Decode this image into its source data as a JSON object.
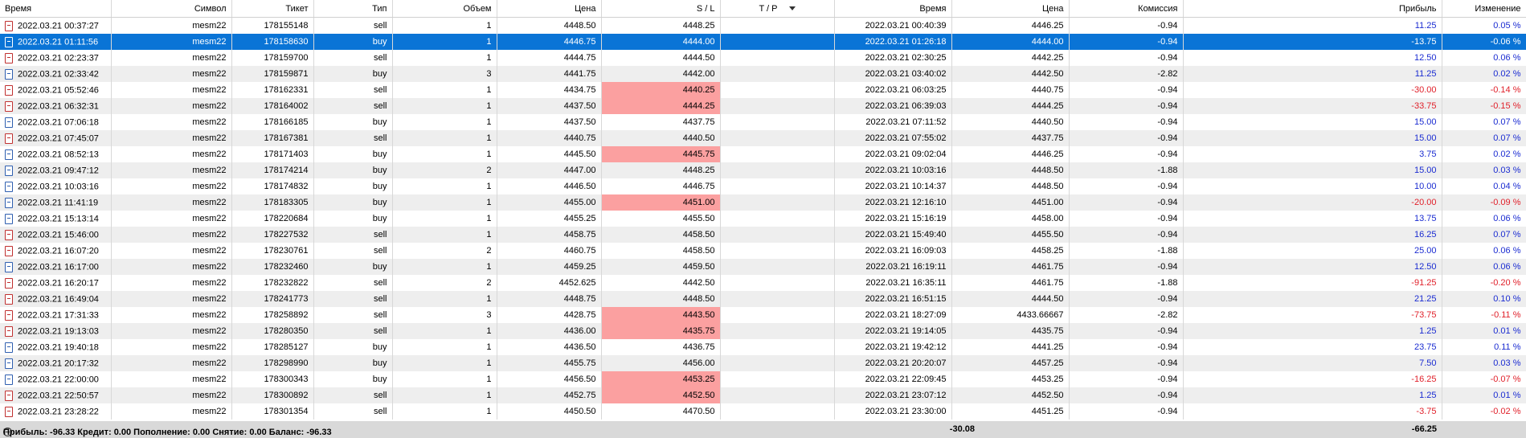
{
  "columns": {
    "time_open": "Время",
    "symbol": "Символ",
    "ticket": "Тикет",
    "type": "Тип",
    "volume": "Объем",
    "price_open": "Цена",
    "sl": "S / L",
    "tp": "T / P",
    "time_close": "Время",
    "price_close": "Цена",
    "commission": "Комиссия",
    "profit": "Прибыль",
    "change": "Изменение"
  },
  "rows": [
    {
      "t1": "2022.03.21 00:37:27",
      "sym": "mesm22",
      "ticket": "178155148",
      "type": "sell",
      "vol": "1",
      "p1": "4448.50",
      "sl": "4448.25",
      "tp": "",
      "t2": "2022.03.21 00:40:39",
      "p2": "4446.25",
      "comm": "-0.94",
      "profit": "11.25",
      "chg": "0.05 %",
      "sel": false,
      "slhit": false
    },
    {
      "t1": "2022.03.21 01:11:56",
      "sym": "mesm22",
      "ticket": "178158630",
      "type": "buy",
      "vol": "1",
      "p1": "4446.75",
      "sl": "4444.00",
      "tp": "",
      "t2": "2022.03.21 01:26:18",
      "p2": "4444.00",
      "comm": "-0.94",
      "profit": "-13.75",
      "chg": "-0.06 %",
      "sel": true,
      "slhit": false
    },
    {
      "t1": "2022.03.21 02:23:37",
      "sym": "mesm22",
      "ticket": "178159700",
      "type": "sell",
      "vol": "1",
      "p1": "4444.75",
      "sl": "4444.50",
      "tp": "",
      "t2": "2022.03.21 02:30:25",
      "p2": "4442.25",
      "comm": "-0.94",
      "profit": "12.50",
      "chg": "0.06 %",
      "sel": false,
      "slhit": false
    },
    {
      "t1": "2022.03.21 02:33:42",
      "sym": "mesm22",
      "ticket": "178159871",
      "type": "buy",
      "vol": "3",
      "p1": "4441.75",
      "sl": "4442.00",
      "tp": "",
      "t2": "2022.03.21 03:40:02",
      "p2": "4442.50",
      "comm": "-2.82",
      "profit": "11.25",
      "chg": "0.02 %",
      "sel": false,
      "slhit": false
    },
    {
      "t1": "2022.03.21 05:52:46",
      "sym": "mesm22",
      "ticket": "178162331",
      "type": "sell",
      "vol": "1",
      "p1": "4434.75",
      "sl": "4440.25",
      "tp": "",
      "t2": "2022.03.21 06:03:25",
      "p2": "4440.75",
      "comm": "-0.94",
      "profit": "-30.00",
      "chg": "-0.14 %",
      "sel": false,
      "slhit": true
    },
    {
      "t1": "2022.03.21 06:32:31",
      "sym": "mesm22",
      "ticket": "178164002",
      "type": "sell",
      "vol": "1",
      "p1": "4437.50",
      "sl": "4444.25",
      "tp": "",
      "t2": "2022.03.21 06:39:03",
      "p2": "4444.25",
      "comm": "-0.94",
      "profit": "-33.75",
      "chg": "-0.15 %",
      "sel": false,
      "slhit": true
    },
    {
      "t1": "2022.03.21 07:06:18",
      "sym": "mesm22",
      "ticket": "178166185",
      "type": "buy",
      "vol": "1",
      "p1": "4437.50",
      "sl": "4437.75",
      "tp": "",
      "t2": "2022.03.21 07:11:52",
      "p2": "4440.50",
      "comm": "-0.94",
      "profit": "15.00",
      "chg": "0.07 %",
      "sel": false,
      "slhit": false
    },
    {
      "t1": "2022.03.21 07:45:07",
      "sym": "mesm22",
      "ticket": "178167381",
      "type": "sell",
      "vol": "1",
      "p1": "4440.75",
      "sl": "4440.50",
      "tp": "",
      "t2": "2022.03.21 07:55:02",
      "p2": "4437.75",
      "comm": "-0.94",
      "profit": "15.00",
      "chg": "0.07 %",
      "sel": false,
      "slhit": false
    },
    {
      "t1": "2022.03.21 08:52:13",
      "sym": "mesm22",
      "ticket": "178171403",
      "type": "buy",
      "vol": "1",
      "p1": "4445.50",
      "sl": "4445.75",
      "tp": "",
      "t2": "2022.03.21 09:02:04",
      "p2": "4446.25",
      "comm": "-0.94",
      "profit": "3.75",
      "chg": "0.02 %",
      "sel": false,
      "slhit": true
    },
    {
      "t1": "2022.03.21 09:47:12",
      "sym": "mesm22",
      "ticket": "178174214",
      "type": "buy",
      "vol": "2",
      "p1": "4447.00",
      "sl": "4448.25",
      "tp": "",
      "t2": "2022.03.21 10:03:16",
      "p2": "4448.50",
      "comm": "-1.88",
      "profit": "15.00",
      "chg": "0.03 %",
      "sel": false,
      "slhit": false
    },
    {
      "t1": "2022.03.21 10:03:16",
      "sym": "mesm22",
      "ticket": "178174832",
      "type": "buy",
      "vol": "1",
      "p1": "4446.50",
      "sl": "4446.75",
      "tp": "",
      "t2": "2022.03.21 10:14:37",
      "p2": "4448.50",
      "comm": "-0.94",
      "profit": "10.00",
      "chg": "0.04 %",
      "sel": false,
      "slhit": false
    },
    {
      "t1": "2022.03.21 11:41:19",
      "sym": "mesm22",
      "ticket": "178183305",
      "type": "buy",
      "vol": "1",
      "p1": "4455.00",
      "sl": "4451.00",
      "tp": "",
      "t2": "2022.03.21 12:16:10",
      "p2": "4451.00",
      "comm": "-0.94",
      "profit": "-20.00",
      "chg": "-0.09 %",
      "sel": false,
      "slhit": true
    },
    {
      "t1": "2022.03.21 15:13:14",
      "sym": "mesm22",
      "ticket": "178220684",
      "type": "buy",
      "vol": "1",
      "p1": "4455.25",
      "sl": "4455.50",
      "tp": "",
      "t2": "2022.03.21 15:16:19",
      "p2": "4458.00",
      "comm": "-0.94",
      "profit": "13.75",
      "chg": "0.06 %",
      "sel": false,
      "slhit": false
    },
    {
      "t1": "2022.03.21 15:46:00",
      "sym": "mesm22",
      "ticket": "178227532",
      "type": "sell",
      "vol": "1",
      "p1": "4458.75",
      "sl": "4458.50",
      "tp": "",
      "t2": "2022.03.21 15:49:40",
      "p2": "4455.50",
      "comm": "-0.94",
      "profit": "16.25",
      "chg": "0.07 %",
      "sel": false,
      "slhit": false
    },
    {
      "t1": "2022.03.21 16:07:20",
      "sym": "mesm22",
      "ticket": "178230761",
      "type": "sell",
      "vol": "2",
      "p1": "4460.75",
      "sl": "4458.50",
      "tp": "",
      "t2": "2022.03.21 16:09:03",
      "p2": "4458.25",
      "comm": "-1.88",
      "profit": "25.00",
      "chg": "0.06 %",
      "sel": false,
      "slhit": false
    },
    {
      "t1": "2022.03.21 16:17:00",
      "sym": "mesm22",
      "ticket": "178232460",
      "type": "buy",
      "vol": "1",
      "p1": "4459.25",
      "sl": "4459.50",
      "tp": "",
      "t2": "2022.03.21 16:19:11",
      "p2": "4461.75",
      "comm": "-0.94",
      "profit": "12.50",
      "chg": "0.06 %",
      "sel": false,
      "slhit": false
    },
    {
      "t1": "2022.03.21 16:20:17",
      "sym": "mesm22",
      "ticket": "178232822",
      "type": "sell",
      "vol": "2",
      "p1": "4452.625",
      "sl": "4442.50",
      "tp": "",
      "t2": "2022.03.21 16:35:11",
      "p2": "4461.75",
      "comm": "-1.88",
      "profit": "-91.25",
      "chg": "-0.20 %",
      "sel": false,
      "slhit": false
    },
    {
      "t1": "2022.03.21 16:49:04",
      "sym": "mesm22",
      "ticket": "178241773",
      "type": "sell",
      "vol": "1",
      "p1": "4448.75",
      "sl": "4448.50",
      "tp": "",
      "t2": "2022.03.21 16:51:15",
      "p2": "4444.50",
      "comm": "-0.94",
      "profit": "21.25",
      "chg": "0.10 %",
      "sel": false,
      "slhit": false
    },
    {
      "t1": "2022.03.21 17:31:33",
      "sym": "mesm22",
      "ticket": "178258892",
      "type": "sell",
      "vol": "3",
      "p1": "4428.75",
      "sl": "4443.50",
      "tp": "",
      "t2": "2022.03.21 18:27:09",
      "p2": "4433.66667",
      "comm": "-2.82",
      "profit": "-73.75",
      "chg": "-0.11 %",
      "sel": false,
      "slhit": true
    },
    {
      "t1": "2022.03.21 19:13:03",
      "sym": "mesm22",
      "ticket": "178280350",
      "type": "sell",
      "vol": "1",
      "p1": "4436.00",
      "sl": "4435.75",
      "tp": "",
      "t2": "2022.03.21 19:14:05",
      "p2": "4435.75",
      "comm": "-0.94",
      "profit": "1.25",
      "chg": "0.01 %",
      "sel": false,
      "slhit": true
    },
    {
      "t1": "2022.03.21 19:40:18",
      "sym": "mesm22",
      "ticket": "178285127",
      "type": "buy",
      "vol": "1",
      "p1": "4436.50",
      "sl": "4436.75",
      "tp": "",
      "t2": "2022.03.21 19:42:12",
      "p2": "4441.25",
      "comm": "-0.94",
      "profit": "23.75",
      "chg": "0.11 %",
      "sel": false,
      "slhit": false
    },
    {
      "t1": "2022.03.21 20:17:32",
      "sym": "mesm22",
      "ticket": "178298990",
      "type": "buy",
      "vol": "1",
      "p1": "4455.75",
      "sl": "4456.00",
      "tp": "",
      "t2": "2022.03.21 20:20:07",
      "p2": "4457.25",
      "comm": "-0.94",
      "profit": "7.50",
      "chg": "0.03 %",
      "sel": false,
      "slhit": false
    },
    {
      "t1": "2022.03.21 22:00:00",
      "sym": "mesm22",
      "ticket": "178300343",
      "type": "buy",
      "vol": "1",
      "p1": "4456.50",
      "sl": "4453.25",
      "tp": "",
      "t2": "2022.03.21 22:09:45",
      "p2": "4453.25",
      "comm": "-0.94",
      "profit": "-16.25",
      "chg": "-0.07 %",
      "sel": false,
      "slhit": true
    },
    {
      "t1": "2022.03.21 22:50:57",
      "sym": "mesm22",
      "ticket": "178300892",
      "type": "sell",
      "vol": "1",
      "p1": "4452.75",
      "sl": "4452.50",
      "tp": "",
      "t2": "2022.03.21 23:07:12",
      "p2": "4452.50",
      "comm": "-0.94",
      "profit": "1.25",
      "chg": "0.01 %",
      "sel": false,
      "slhit": true
    },
    {
      "t1": "2022.03.21 23:28:22",
      "sym": "mesm22",
      "ticket": "178301354",
      "type": "sell",
      "vol": "1",
      "p1": "4450.50",
      "sl": "4470.50",
      "tp": "",
      "t2": "2022.03.21 23:30:00",
      "p2": "4451.25",
      "comm": "-0.94",
      "profit": "-3.75",
      "chg": "-0.02 %",
      "sel": false,
      "slhit": false
    }
  ],
  "summary": {
    "text": "Прибыль: -96.33  Кредит: 0.00  Пополнение: 0.00  Снятие: 0.00  Баланс: -96.33",
    "commission_total": "-30.08",
    "profit_total": "-66.25"
  },
  "colors": {
    "selected_row": "#0a74d6",
    "sl_hit": "#fba0a0",
    "positive": "#1a2bd1",
    "negative": "#e0202a"
  }
}
